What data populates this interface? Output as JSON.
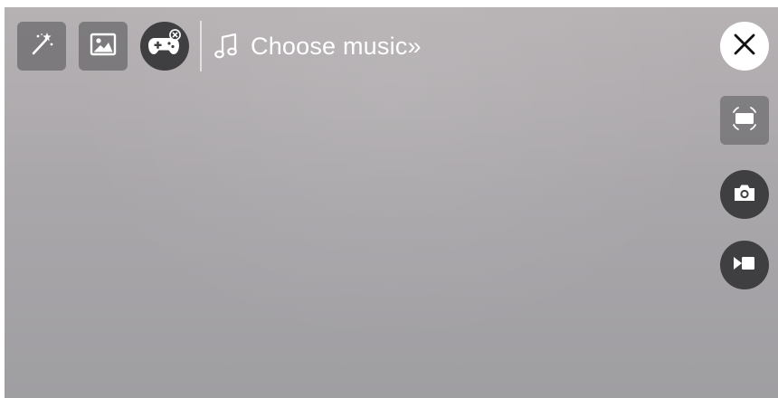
{
  "toolbar": {
    "effects_icon": "magic-wand-icon",
    "image_icon": "image-icon",
    "game_icon": "gamepad-off-icon",
    "music": {
      "icon": "music-note-icon",
      "label": "Choose music»"
    }
  },
  "side_controls": {
    "close_icon": "close-icon",
    "screen_mode_icon": "screen-frame-icon",
    "screenshot_icon": "camera-icon",
    "record_icon": "video-record-icon"
  }
}
